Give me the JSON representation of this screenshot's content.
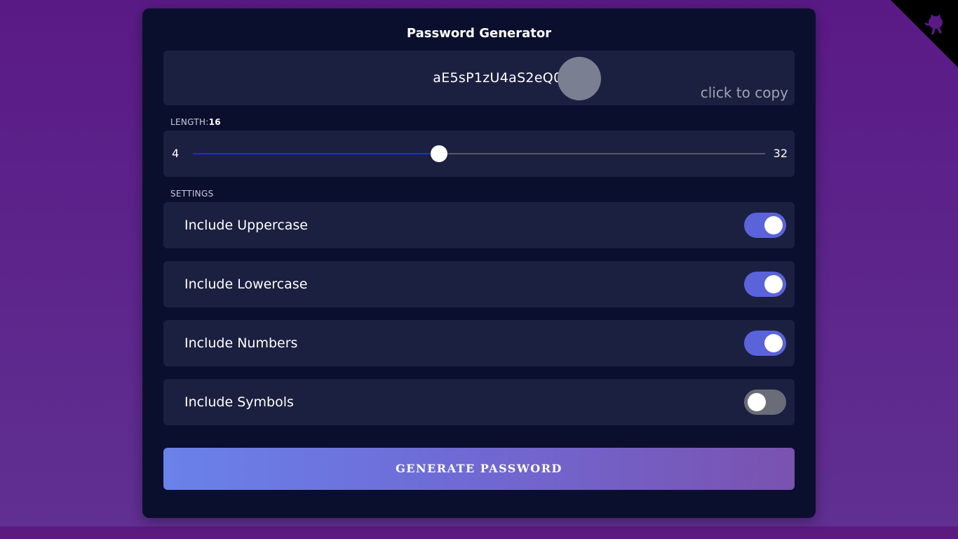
{
  "app": {
    "title": "Password Generator"
  },
  "password": {
    "value": "aE5sP1zU4aS2eQ0x",
    "copy_hint": "click to copy"
  },
  "length": {
    "label": "LENGTH:",
    "value": "16",
    "min": "4",
    "max": "32",
    "fraction": 0.43
  },
  "settings": {
    "label": "SETTINGS",
    "options": [
      {
        "label": "Include Uppercase",
        "enabled": true
      },
      {
        "label": "Include Lowercase",
        "enabled": true
      },
      {
        "label": "Include Numbers",
        "enabled": true
      },
      {
        "label": "Include Symbols",
        "enabled": false
      }
    ]
  },
  "generate_button": {
    "label": "GENERATE PASSWORD"
  },
  "colors": {
    "toggle_on": "#5a63da",
    "toggle_off": "#6a6d78",
    "slider_fill": "#1e2fd0",
    "card_background": "#0b0f2e",
    "panel_background": "#1c2040"
  },
  "icons": {
    "corner": "github-octocat-icon"
  }
}
